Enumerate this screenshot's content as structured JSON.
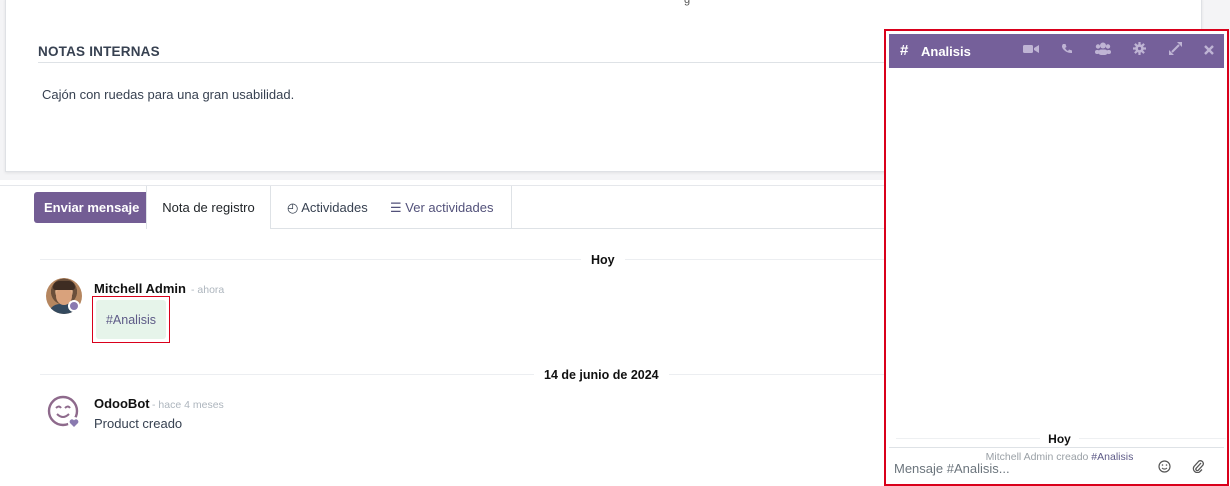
{
  "form": {
    "notes_title": "NOTAS INTERNAS",
    "notes_text": "Cajón con ruedas para una gran usabilidad.",
    "corner_mark": "g"
  },
  "chatter": {
    "send_message_label": "Enviar mensaje",
    "log_note_label": "Nota de registro",
    "activities_label": "Actividades",
    "view_activities_label": "Ver actividades",
    "accent_color": "#735d94"
  },
  "messages": {
    "today_label": "Hoy",
    "older_label": "14 de junio de 2024",
    "m1": {
      "author": "Mitchell Admin",
      "time": "- ahora",
      "body": "#Analisis"
    },
    "m2": {
      "author": "OdooBot",
      "time": "- hace 4 meses",
      "body": "Product creado"
    }
  },
  "chat_window": {
    "hash": "#",
    "title": "Analisis",
    "header_color": "#75609a",
    "icons": [
      "video-icon",
      "phone-icon",
      "users-icon",
      "gear-icon",
      "expand-icon",
      "close-icon"
    ],
    "today_label": "Hoy",
    "notice_prefix": "Mitchell Admin creado ",
    "notice_channel": "#Analisis",
    "input_placeholder": "Mensaje #Analisis..."
  }
}
